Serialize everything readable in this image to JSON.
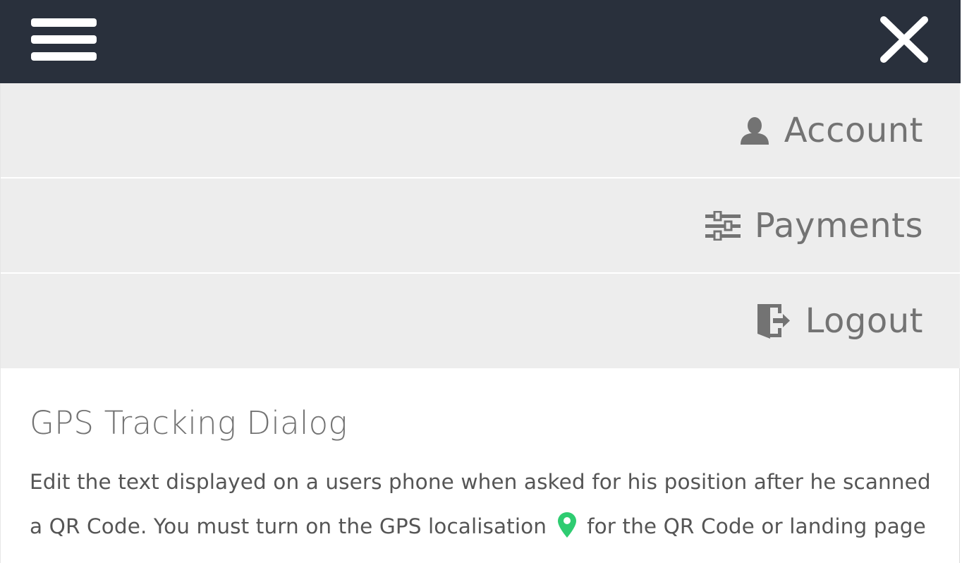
{
  "topbar": {
    "menu_icon": "hamburger-icon",
    "close_icon": "close-icon",
    "background": "#29303c"
  },
  "menu": {
    "items": [
      {
        "label": "Account",
        "icon": "user-icon"
      },
      {
        "label": "Payments",
        "icon": "sliders-icon"
      },
      {
        "label": "Logout",
        "icon": "logout-icon"
      }
    ]
  },
  "content": {
    "title": "GPS Tracking Dialog",
    "description_before": "Edit the text displayed on a users phone when asked for his position after he scanned a QR Code. You must turn on the GPS localisation",
    "description_after": "for the QR Code or landing page",
    "pin_icon": "map-pin-icon",
    "pin_color": "#2ecc71"
  }
}
